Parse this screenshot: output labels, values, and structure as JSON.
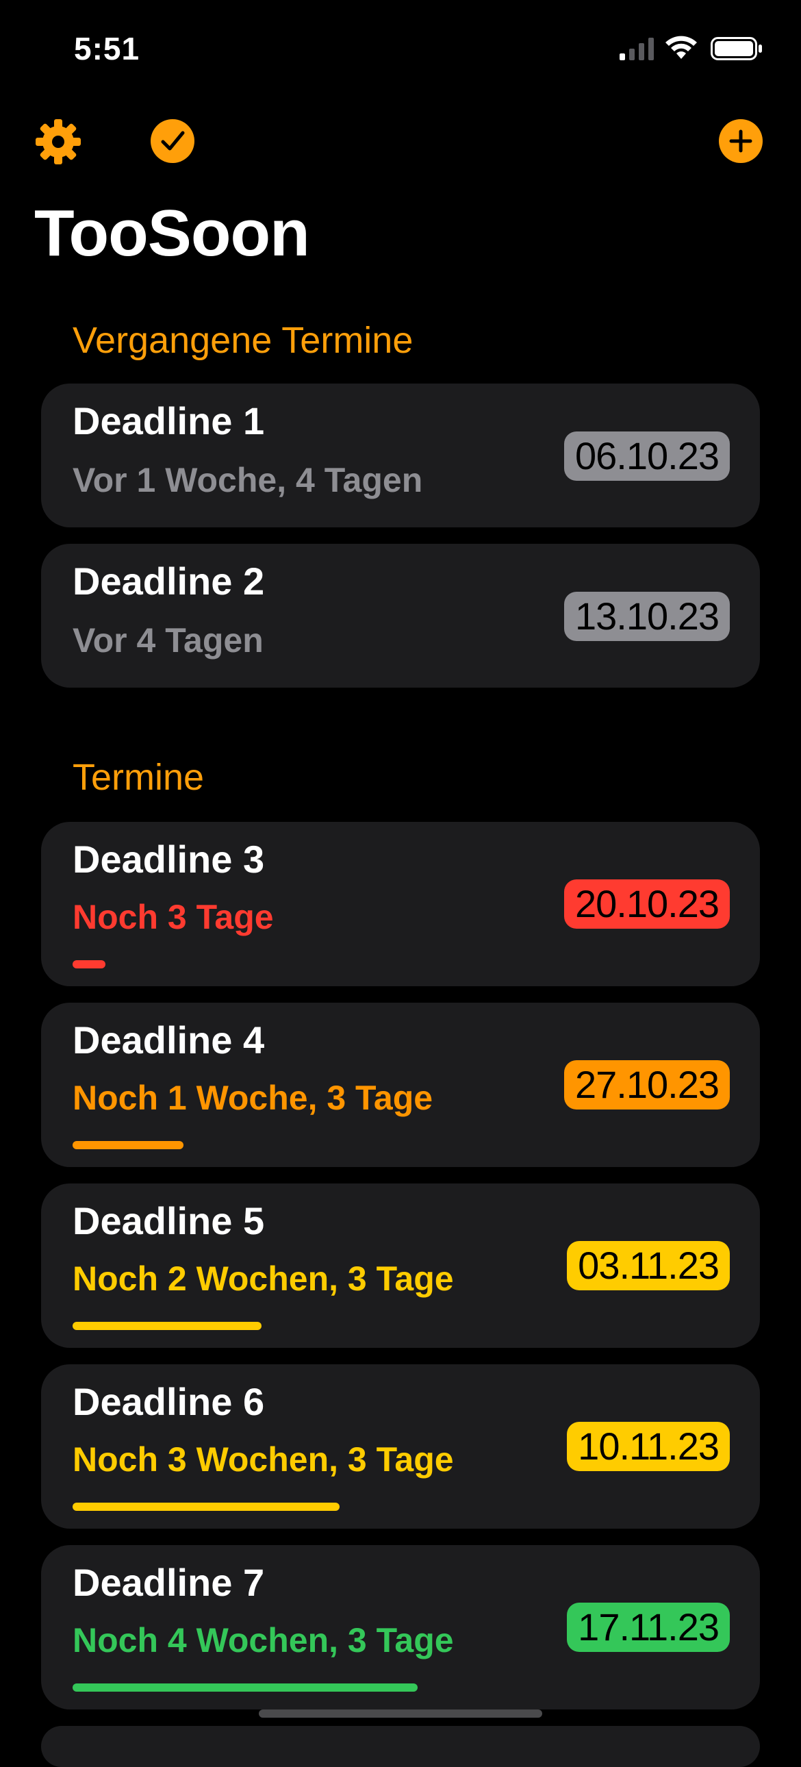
{
  "status": {
    "time": "5:51"
  },
  "toolbar": {
    "settings_icon": "gear-icon",
    "done_icon": "checkmark-circle-icon",
    "add_icon": "plus-circle-icon",
    "accent": "#ff9f0a"
  },
  "app": {
    "title": "TooSoon"
  },
  "sections": {
    "past": {
      "header": "Vergangene Termine",
      "items": [
        {
          "title": "Deadline 1",
          "subtitle": "Vor 1 Woche, 4 Tagen",
          "date": "06.10.23",
          "color": "#8e8e93"
        },
        {
          "title": "Deadline 2",
          "subtitle": "Vor 4 Tagen",
          "date": "13.10.23",
          "color": "#8e8e93"
        }
      ]
    },
    "upcoming": {
      "header": "Termine",
      "items": [
        {
          "title": "Deadline 3",
          "subtitle": "Noch 3 Tage",
          "date": "20.10.23",
          "color": "#ff3b30",
          "progress": 0.05
        },
        {
          "title": "Deadline 4",
          "subtitle": "Noch 1 Woche, 3 Tage",
          "date": "27.10.23",
          "color": "#ff9500",
          "progress": 0.17
        },
        {
          "title": "Deadline 5",
          "subtitle": "Noch 2 Wochen, 3 Tage",
          "date": "03.11.23",
          "color": "#ffcc00",
          "progress": 0.29
        },
        {
          "title": "Deadline 6",
          "subtitle": "Noch 3 Wochen, 3 Tage",
          "date": "10.11.23",
          "color": "#ffcc00",
          "progress": 0.41
        },
        {
          "title": "Deadline 7",
          "subtitle": "Noch 4 Wochen, 3 Tage",
          "date": "17.11.23",
          "color": "#34c759",
          "progress": 0.53
        }
      ]
    }
  }
}
